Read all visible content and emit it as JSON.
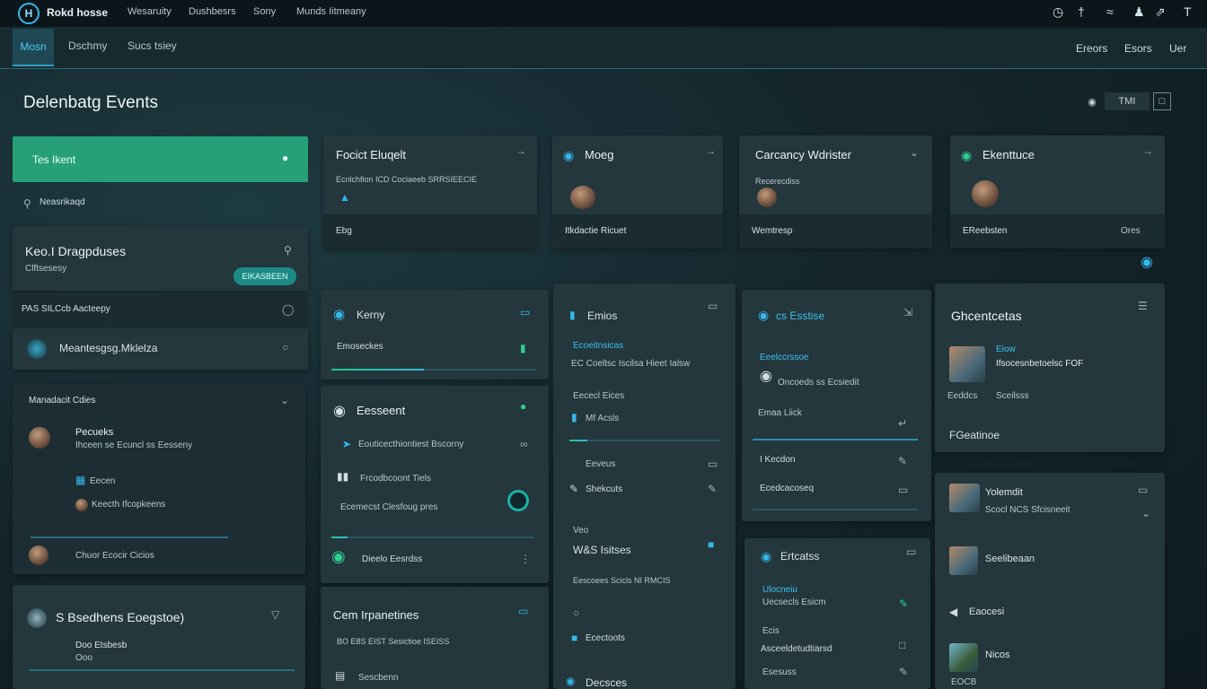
{
  "topbar": {
    "logo": "H",
    "brand": "Rokd hosse",
    "nav": [
      "Wesaruity",
      "Dushbesrs",
      "Sony",
      "Munds Iitmeany"
    ],
    "icons": [
      "bell-icon",
      "chat-icon",
      "wave-icon",
      "person-icon",
      "expand-icon",
      "text-icon"
    ]
  },
  "subbar": {
    "tabs": [
      "Mosn",
      "Dschmy",
      "Sucs tsiey"
    ],
    "right": [
      "Ereors",
      "Esors",
      "Uer"
    ]
  },
  "page": {
    "title": "Delenbatg Events",
    "tool_label": "TMI"
  },
  "left": {
    "active_item": "Tes Ikent",
    "search_label": "Neasrikaqd",
    "panel1": {
      "title": "Keo.I Dragpduses",
      "subtitle": "Clftsesesy",
      "badge": "EIKASBEEN"
    },
    "row1": "PAS SILCcb Aacteepy",
    "row2": "Meantesgsg.Mklelza",
    "panel2": {
      "title": "Manadacit Cdies",
      "item_title": "Pecueks",
      "item_sub": "Ihceen se Ecuncl ss Eesseny",
      "sub1": "Eecen",
      "sub2": "Keecth Ifcopkeens",
      "footer": "Chuor Ecocir Cicios"
    },
    "panel3": {
      "title": "S Bsedhens Eoegstoe)",
      "line1": "Doo Etsbesb",
      "line2": "Ooo"
    }
  },
  "cards_top": [
    {
      "title": "Focict Eluqelt",
      "line1": "Ecnlchfion ICD Cociaeeb SRRSIEECIE",
      "foot": "Ebg"
    },
    {
      "title": "Moeg",
      "foot": "Itkdactie Ricuet"
    },
    {
      "title": "Carcancy Wdrister",
      "line1": "Recerecdiss",
      "foot": "Wemtresp"
    },
    {
      "title": "Ekenttuce",
      "foot": "EReebsten",
      "foot_right": "Ores"
    }
  ],
  "col2": {
    "card1": {
      "title": "Kerny",
      "line": "Emoseckes"
    },
    "card2": {
      "title": "Eesseent",
      "items": [
        "Eouticecthiontiest Bscorny",
        "Frcodbcoont Tiels",
        "Ecemecst Clesfoug pres"
      ],
      "footer": "Dieelo Eesrdss"
    },
    "card3": {
      "title": "Cem Irpanetines",
      "line1": "BO  E8S  EIST Sesictioe  ISEISS",
      "line2": "Sescbenn"
    }
  },
  "col3": {
    "title": "Emios",
    "subtitle": "Ecoeitnsicas",
    "line1": "EC Coeltsc Iscilsa Hieet Ialsw",
    "line2": "Eececl Eices",
    "line3": "Mf Acsls",
    "rows": [
      "Eeveus",
      "Shekcuts"
    ],
    "sec2": "Veo",
    "sec2_title": "W&S Isitses",
    "sec2_line": "Eescoees Scicls NI RMCIS",
    "sec2_foot": "Ecectoots",
    "bottom": "Decsces"
  },
  "col4": {
    "title": "cs Esstise",
    "line1": "Eeelccrssoe",
    "line2": "Oncoeds ss Ecsiedit",
    "line3": "Emaa Liick",
    "rows": [
      "I Kecdon",
      "Ecedcacoseq"
    ],
    "card2": {
      "title": "Ertcatss",
      "line1": "Ulocneiu",
      "line2": "Uecsecls Esicm",
      "line3": "Ecis",
      "line4": "Asceeldetudtiarsd",
      "line5": "Esesuss"
    }
  },
  "col5": {
    "title": "Ghcentcetas",
    "item_title": "Eiow",
    "item_line": "Ifsocesnbetoelsc FOF",
    "item_line2": "Eeddcs",
    "item_line3": "Sceilsss",
    "footer": "FGeatinoe",
    "list": [
      {
        "title": "Yolemdit",
        "sub": "Scocl NCS Sfcisneeit"
      },
      {
        "title": "Seelibeaan"
      },
      {
        "title": "Eaocesi"
      },
      {
        "title": "Nicos",
        "sub": "EOCB"
      }
    ]
  }
}
